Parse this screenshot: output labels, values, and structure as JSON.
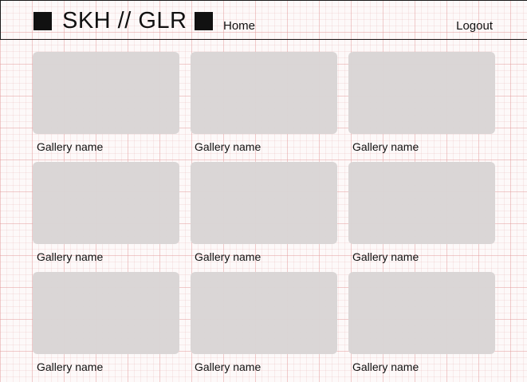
{
  "header": {
    "brand": "SKH // GLR",
    "nav_home": "Home",
    "logout": "Logout"
  },
  "galleries": [
    {
      "name": "Gallery name"
    },
    {
      "name": "Gallery name"
    },
    {
      "name": "Gallery name"
    },
    {
      "name": "Gallery name"
    },
    {
      "name": "Gallery name"
    },
    {
      "name": "Gallery name"
    },
    {
      "name": "Gallery name"
    },
    {
      "name": "Gallery name"
    },
    {
      "name": "Gallery name"
    }
  ],
  "colors": {
    "thumbnail": "#d9d5d5",
    "text": "#111111",
    "grid_line": "#e29696"
  }
}
